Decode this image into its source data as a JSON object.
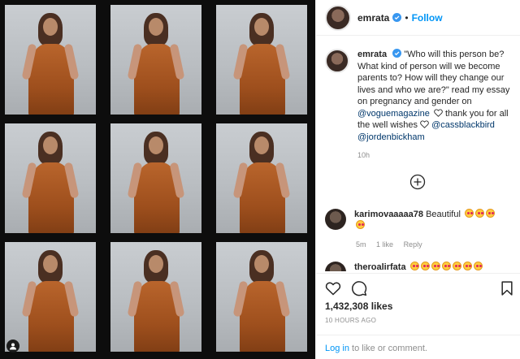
{
  "post": {
    "username": "emrata",
    "follow_label": "Follow",
    "separator": "•",
    "caption": {
      "username": "emrata",
      "text_part1": "\"Who will this person be? What kind of person will we become parents to? How will they change our lives and who we are?\" read my essay on pregnancy and gender on ",
      "mention_vogue": "@voguemagazine",
      "text_part2": " thank you for all the well wishes ",
      "mention_cass": "@cassblackbird",
      "mention_jorden": "@jordenbickham",
      "time": "10h"
    },
    "comments": [
      {
        "username": "karimovaaaaa78",
        "text": "Beautiful",
        "time": "5m",
        "likes": "1 like",
        "reply": "Reply"
      },
      {
        "username": "theroalirfata",
        "text": ""
      }
    ],
    "likes_count": "1,432,308 likes",
    "time_ago": "10 HOURS AGO",
    "login_link": "Log in",
    "login_text": " to like or comment."
  },
  "icons": {
    "verified": "verified-badge-icon",
    "add": "add-circle-icon",
    "like": "heart-icon",
    "comment": "comment-icon",
    "bookmark": "bookmark-icon"
  },
  "colors": {
    "accent": "#0095f6",
    "text": "#262626",
    "muted": "#8e8e8e",
    "dress": "#b9652c"
  }
}
